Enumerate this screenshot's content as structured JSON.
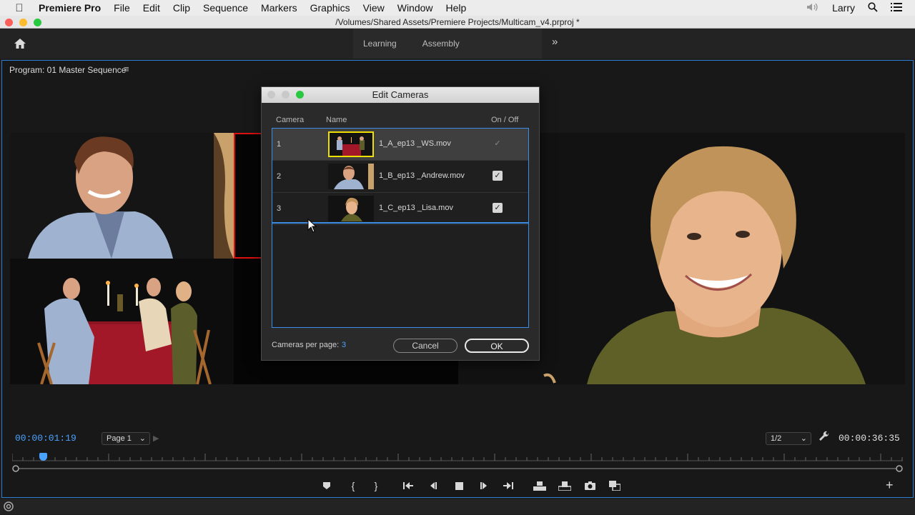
{
  "menubar": {
    "app": "Premiere Pro",
    "items": [
      "File",
      "Edit",
      "Clip",
      "Sequence",
      "Markers",
      "Graphics",
      "View",
      "Window",
      "Help"
    ],
    "user": "Larry"
  },
  "window": {
    "title": "/Volumes/Shared Assets/Premiere Projects/Multicam_v4.prproj *"
  },
  "workspaces": {
    "tabs": [
      "Learning",
      "Assembly"
    ]
  },
  "program": {
    "title": "Program: 01 Master Sequence",
    "timecode_current": "00:00:01:19",
    "timecode_duration": "00:00:36:35",
    "page_select": "Page 1",
    "resolution_select": "1/2"
  },
  "dialog": {
    "title": "Edit Cameras",
    "col_camera": "Camera",
    "col_name": "Name",
    "col_onoff": "On / Off",
    "cameras": [
      {
        "num": "1",
        "name": "1_A_ep13 _WS.mov",
        "on": true
      },
      {
        "num": "2",
        "name": "1_B_ep13 _Andrew.mov",
        "on": true
      },
      {
        "num": "3",
        "name": "1_C_ep13 _Lisa.mov",
        "on": true
      }
    ],
    "cameras_per_page_label": "Cameras per page:",
    "cameras_per_page_value": "3",
    "cancel": "Cancel",
    "ok": "OK"
  },
  "icons": [
    "apple-icon",
    "volume-icon",
    "search-icon",
    "list-icon",
    "home-icon",
    "chevron-double-right-icon",
    "menu-icon",
    "wrench-icon",
    "marker-icon",
    "mark-in-icon",
    "mark-out-icon",
    "go-to-in-icon",
    "step-back-icon",
    "stop-icon",
    "step-forward-icon",
    "go-to-out-icon",
    "insert-icon",
    "overwrite-icon",
    "camera-icon",
    "multicam-icon",
    "add-icon",
    "creative-cloud-icon"
  ],
  "colors": {
    "accent": "#3a8ee6",
    "timecode": "#4aa3ff",
    "highlight": "#f0e000",
    "tally_red": "#e01010"
  }
}
